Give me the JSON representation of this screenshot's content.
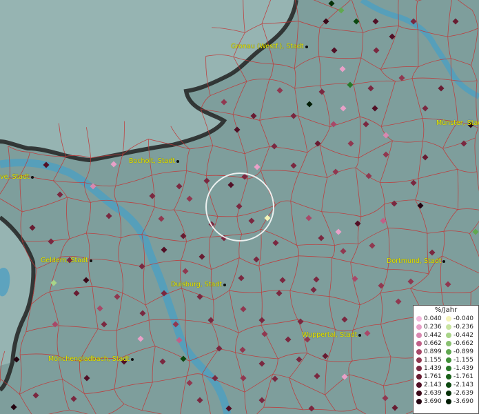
{
  "map": {
    "cities": [
      {
        "id": "gronau",
        "name": "Gronau (Westf.), Stadt"
      },
      {
        "id": "bocholt",
        "name": "Bocholt, Stadt"
      },
      {
        "id": "wesel",
        "name": "ve, Stadt"
      },
      {
        "id": "muenster",
        "name": "Münster, Stadt"
      },
      {
        "id": "geldern",
        "name": "Geldern, Stadt"
      },
      {
        "id": "duisburg",
        "name": "Duisburg, Stadt"
      },
      {
        "id": "dortmund",
        "name": "Dortmund, Stadt"
      },
      {
        "id": "wuppertal",
        "name": "Wuppertal, Stadt"
      },
      {
        "id": "moenchengladbach",
        "name": "Mönchengladbach, Stadt"
      }
    ]
  },
  "legend": {
    "title": "%/Jahr",
    "positive": [
      {
        "label": "0.040",
        "color": "#f4b8dc"
      },
      {
        "label": "0.236",
        "color": "#e8a0c8"
      },
      {
        "label": "0.442",
        "color": "#d888b0"
      },
      {
        "label": "0.662",
        "color": "#c06088"
      },
      {
        "label": "0.899",
        "color": "#a84868"
      },
      {
        "label": "1.155",
        "color": "#903850"
      },
      {
        "label": "1.439",
        "color": "#7a2840"
      },
      {
        "label": "1.761",
        "color": "#681c32"
      },
      {
        "label": "2.143",
        "color": "#521026"
      },
      {
        "label": "2.639",
        "color": "#3c0818"
      },
      {
        "label": "3.690",
        "color": "#240410"
      }
    ],
    "negative": [
      {
        "label": "-0.040",
        "color": "#f4f4b8"
      },
      {
        "label": "-0.236",
        "color": "#c8e4a0"
      },
      {
        "label": "-0.442",
        "color": "#a8d488"
      },
      {
        "label": "-0.662",
        "color": "#88c070"
      },
      {
        "label": "-0.899",
        "color": "#60a850"
      },
      {
        "label": "-1.155",
        "color": "#409038"
      },
      {
        "label": "-1.439",
        "color": "#287828"
      },
      {
        "label": "-1.761",
        "color": "#186018"
      },
      {
        "label": "-2.143",
        "color": "#0c4810"
      },
      {
        "label": "-2.639",
        "color": "#063008"
      },
      {
        "label": "-3.690",
        "color": "#021c04"
      }
    ]
  }
}
